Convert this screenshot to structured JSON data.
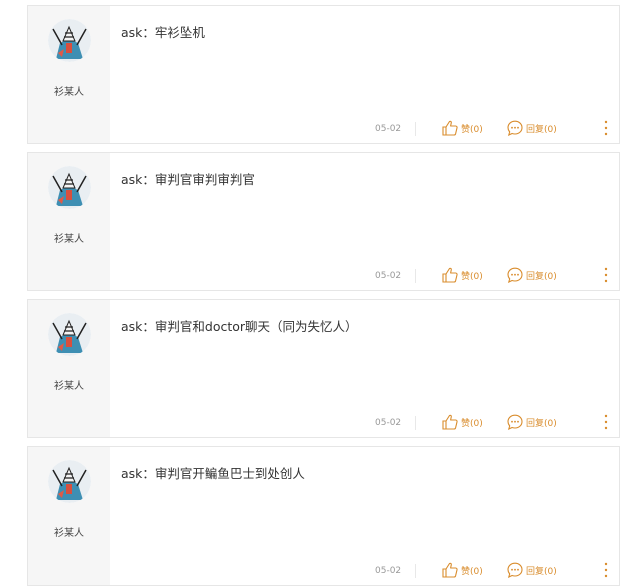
{
  "colors": {
    "accent": "#d98c2c",
    "border": "#e6e6e6",
    "user_column_bg": "#f6f6f6",
    "text": "#333333",
    "date": "#999999"
  },
  "icons": {
    "like": "thumbs-up-icon",
    "reply": "speech-bubble-icon",
    "more": "vertical-ellipsis-icon"
  },
  "posts": [
    {
      "username": "衫某人",
      "content": "ask：牢衫坠机",
      "date": "05-02",
      "like_label": "赞(0)",
      "reply_label": "回复(0)"
    },
    {
      "username": "衫某人",
      "content": "ask：审判官审判审判官",
      "date": "05-02",
      "like_label": "赞(0)",
      "reply_label": "回复(0)"
    },
    {
      "username": "衫某人",
      "content": "ask：审判官和doctor聊天（同为失忆人）",
      "date": "05-02",
      "like_label": "赞(0)",
      "reply_label": "回复(0)"
    },
    {
      "username": "衫某人",
      "content": "ask：审判官开鳊鱼巴士到处创人",
      "date": "05-02",
      "like_label": "赞(0)",
      "reply_label": "回复(0)"
    }
  ]
}
